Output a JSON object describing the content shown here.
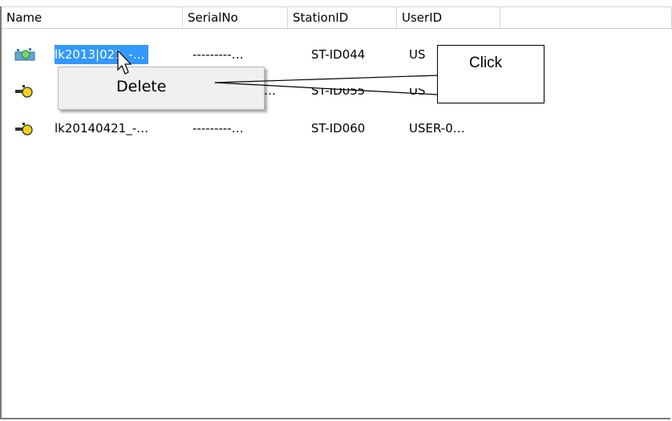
{
  "columns": [
    {
      "label": "Name"
    },
    {
      "label": "SerialNo"
    },
    {
      "label": "StationID"
    },
    {
      "label": "UserID"
    },
    {
      "label": ""
    }
  ],
  "rows": [
    {
      "name": "lk2013|021_-…",
      "serial": "---------…",
      "station": "ST-ID044",
      "user": "US",
      "icon": "station-icon-active",
      "selected": true
    },
    {
      "name": "",
      "serial": "…",
      "station": "ST-ID055",
      "user": "US",
      "icon": "station-icon",
      "selected": false
    },
    {
      "name": "lk20140421_-…",
      "serial": "---------…",
      "station": "ST-ID060",
      "user": "USER-0…",
      "icon": "station-icon",
      "selected": false
    }
  ],
  "context_menu": {
    "items": [
      {
        "label": "Delete"
      }
    ]
  },
  "callout": {
    "text": "Click"
  },
  "colors": {
    "selection": "#3399ff",
    "menu_bg": "#f0f0f0"
  }
}
